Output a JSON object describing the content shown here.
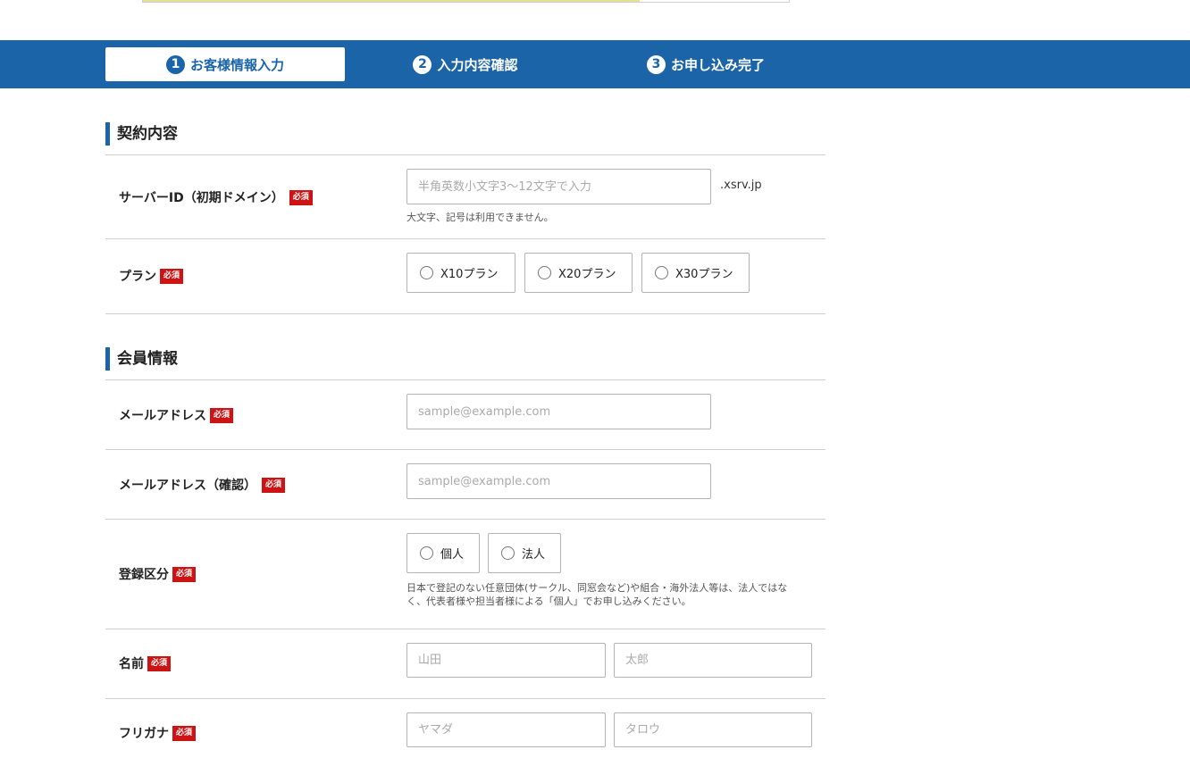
{
  "steps": [
    {
      "num": "1",
      "label": "お客様情報入力"
    },
    {
      "num": "2",
      "label": "入力内容確認"
    },
    {
      "num": "3",
      "label": "お申し込み完了"
    }
  ],
  "contract": {
    "title": "契約内容",
    "server_id": {
      "label": "サーバーID（初期ドメイン）",
      "placeholder": "半角英数小文字3〜12文字で入力",
      "suffix": ".xsrv.jp",
      "note": "大文字、記号は利用できません。"
    },
    "plan": {
      "label": "プラン",
      "options": [
        "X10プラン",
        "X20プラン",
        "X30プラン"
      ]
    }
  },
  "member": {
    "title": "会員情報",
    "email": {
      "label": "メールアドレス",
      "placeholder": "sample@example.com"
    },
    "email_confirm": {
      "label": "メールアドレス（確認）",
      "placeholder": "sample@example.com"
    },
    "registration_type": {
      "label": "登録区分",
      "options": [
        "個人",
        "法人"
      ],
      "note_line1": "日本で登記のない任意団体(サークル、同窓会など)や組合・海外法人等は、法人ではな",
      "note_line2": "く、代表者様や担当者様による「個人」でお申し込みください。"
    },
    "name": {
      "label": "名前",
      "placeholder_last": "山田",
      "placeholder_first": "太郎"
    },
    "furigana": {
      "label": "フリガナ",
      "placeholder_last": "ヤマダ",
      "placeholder_first": "タロウ"
    }
  },
  "required_badge": "必須",
  "colors": {
    "brand": "#1b64a8",
    "required": "#cc1414"
  }
}
